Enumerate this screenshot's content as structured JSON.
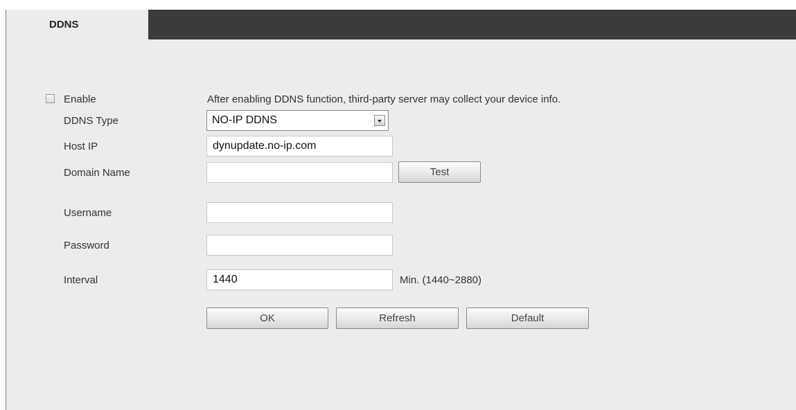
{
  "tab": {
    "label": "DDNS"
  },
  "enable": {
    "label": "Enable",
    "checked": false
  },
  "notice": "After enabling DDNS function, third-party server may collect your device info.",
  "fields": {
    "ddns_type": {
      "label": "DDNS Type",
      "value": "NO-IP DDNS"
    },
    "host_ip": {
      "label": "Host IP",
      "value": "dynupdate.no-ip.com"
    },
    "domain_name": {
      "label": "Domain Name",
      "value": ""
    },
    "username": {
      "label": "Username",
      "value": ""
    },
    "password": {
      "label": "Password",
      "value": ""
    },
    "interval": {
      "label": "Interval",
      "value": "1440",
      "hint": "Min. (1440~2880)"
    }
  },
  "buttons": {
    "test": "Test",
    "ok": "OK",
    "refresh": "Refresh",
    "default": "Default"
  },
  "icons": {
    "dropdown": "chevron-down-icon",
    "checkbox": "checkbox-icon"
  },
  "colors": {
    "tab_bar": "#3b3b3b",
    "panel": "#ececec",
    "text": "#333333"
  }
}
